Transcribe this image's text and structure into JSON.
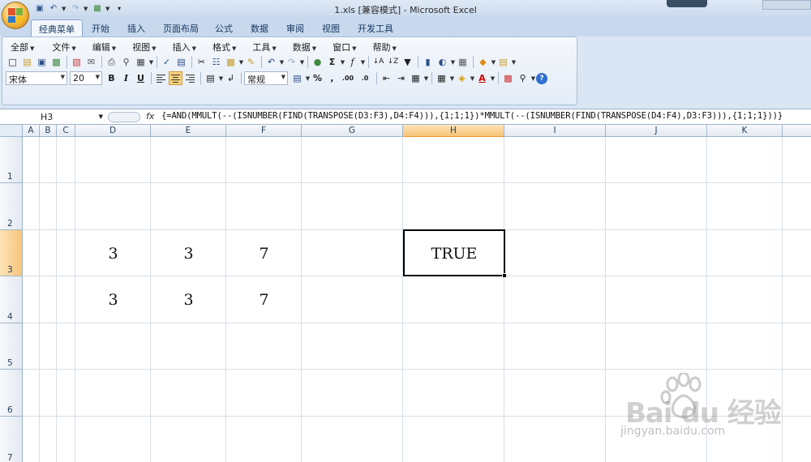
{
  "titlebar": {
    "title": "1.xls  [兼容模式] - Microsoft Excel",
    "quick_access": [
      "save-icon",
      "undo-icon",
      "redo-icon",
      "macro-icon"
    ]
  },
  "ribbon_tabs": [
    "经典菜单",
    "开始",
    "插入",
    "页面布局",
    "公式",
    "数据",
    "审阅",
    "视图",
    "开发工具"
  ],
  "active_tab": "经典菜单",
  "menu": [
    "全部",
    "文件",
    "编辑",
    "视图",
    "插入",
    "格式",
    "工具",
    "数据",
    "窗口",
    "帮助"
  ],
  "font": {
    "name": "宋体",
    "size": "20"
  },
  "format": {
    "bold": "B",
    "italic": "I",
    "underline": "U",
    "number_format": "常规",
    "percent": "%",
    "comma": ",",
    "inc_decimal": ".00",
    "dec_decimal": ".0"
  },
  "formula_bar": {
    "name_box": "H3",
    "fx_label": "fx",
    "formula": "{=AND(MMULT(--(ISNUMBER(FIND(TRANSPOSE(D3:F3),D4:F4))),{1;1;1})*MMULT(--(ISNUMBER(FIND(TRANSPOSE(D4:F4),D3:F3))),{1;1;1}))}"
  },
  "columns": [
    "A",
    "B",
    "C",
    "D",
    "E",
    "F",
    "G",
    "H",
    "I",
    "J",
    "K"
  ],
  "rows": [
    "1",
    "2",
    "3",
    "4",
    "5",
    "6",
    "7"
  ],
  "selected_column": "H",
  "selected_row": "3",
  "cells": {
    "D3": "3",
    "E3": "3",
    "F3": "7",
    "D4": "3",
    "E4": "3",
    "F4": "7",
    "H3": "TRUE"
  },
  "watermark": {
    "brand": "Bai du 经验",
    "url": "jingyan.baidu.com"
  },
  "colors": {
    "selection_header": "#f7c57a",
    "ribbon_bg": "#dbe6f4",
    "grid_line": "#d6dee8"
  }
}
